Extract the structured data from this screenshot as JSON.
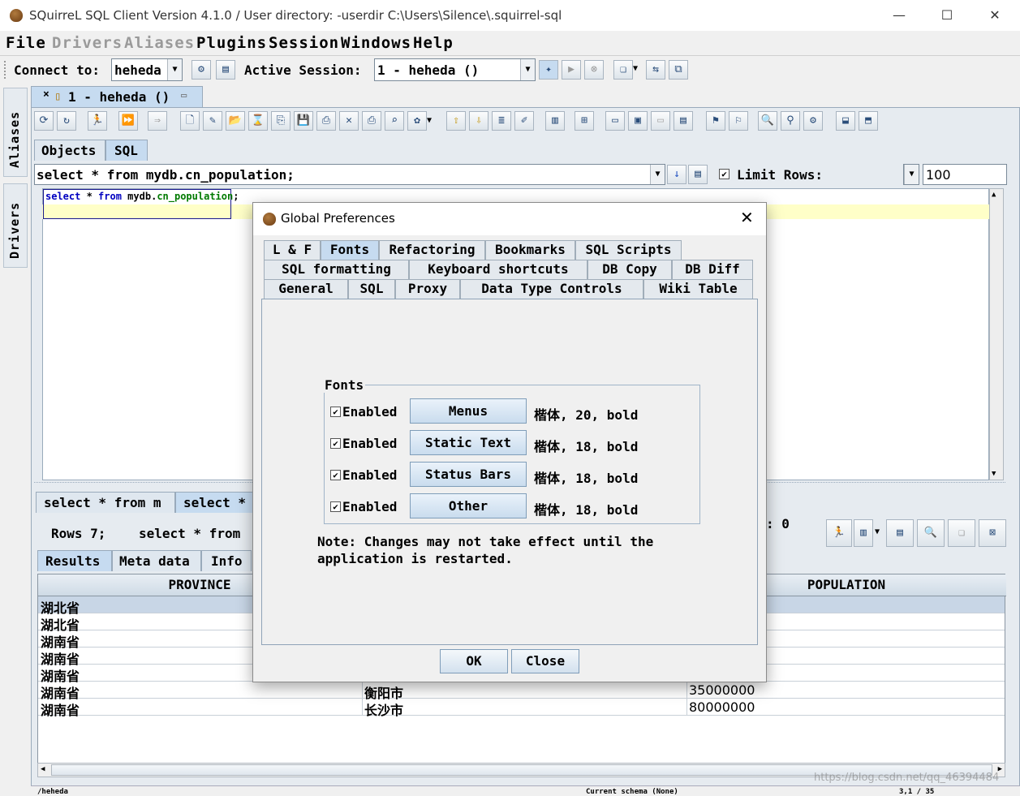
{
  "window": {
    "title": "SQuirreL SQL Client Version 4.1.0 / User directory: -userdir C:\\Users\\Silence\\.squirrel-sql",
    "minimize": "—",
    "maximize": "☐",
    "close": "✕"
  },
  "menubar": {
    "items": [
      {
        "label": "File",
        "enabled": true
      },
      {
        "label": "Drivers",
        "enabled": false
      },
      {
        "label": "Aliases",
        "enabled": false
      },
      {
        "label": "Plugins",
        "enabled": true
      },
      {
        "label": "Session",
        "enabled": true
      },
      {
        "label": "Windows",
        "enabled": true
      },
      {
        "label": "Help",
        "enabled": true
      }
    ]
  },
  "connectbar": {
    "connect_label": "Connect to:",
    "connect_value": "heheda",
    "active_session_label": "Active Session:",
    "active_session_value": "1 - heheda ()"
  },
  "lefttabs": {
    "aliases": "Aliases",
    "drivers": "Drivers"
  },
  "session": {
    "tab_label": "1 - heheda ()",
    "subtabs": {
      "objects": "Objects",
      "sql": "SQL"
    },
    "sql_combo_value": "select * from mydb.cn_population;",
    "limit_rows_label": "Limit Rows:",
    "limit_rows_checked": true,
    "limit_rows_value": "100",
    "editor": {
      "kw_select": "select",
      "star": " * ",
      "kw_from": "from",
      "schema": " mydb.",
      "table": "cn_population",
      "semicolon": ";"
    },
    "result_tabs": [
      "select * from m",
      "select *"
    ],
    "rows_info": "Rows 7;",
    "rows_sql": "select * from",
    "status_partial": ": 0",
    "result_subtabs": [
      "Results",
      "Meta data",
      "Info"
    ],
    "columns": [
      "PROVINCE",
      "POPULATION"
    ],
    "rows": [
      {
        "province": "湖北省",
        "city": "",
        "population": ""
      },
      {
        "province": "湖北省",
        "city": "",
        "population": ""
      },
      {
        "province": "湖南省",
        "city": "",
        "population": ""
      },
      {
        "province": "湖南省",
        "city": "",
        "population": ""
      },
      {
        "province": "湖南省",
        "city": "",
        "population": ""
      },
      {
        "province": "湖南省",
        "city": "衡阳市",
        "population": "35000000"
      },
      {
        "province": "湖南省",
        "city": "长沙市",
        "population": "80000000"
      }
    ],
    "statusbar_left": "/heheda",
    "statusbar_mid": "Current schema (None)",
    "statusbar_right": "3,1 / 35"
  },
  "dialog": {
    "title": "Global Preferences",
    "tabs_row1": [
      "L & F",
      "Fonts",
      "Refactoring",
      "Bookmarks",
      "SQL Scripts"
    ],
    "tabs_row2": [
      "SQL formatting",
      "Keyboard shortcuts",
      "DB Copy",
      "DB Diff"
    ],
    "tabs_row3": [
      "General",
      "SQL",
      "Proxy",
      "Data Type Controls",
      "Wiki Table"
    ],
    "active_tab": "Fonts",
    "group_title": "Fonts",
    "font_rows": [
      {
        "enabled_label": "Enabled",
        "checked": true,
        "button": "Menus",
        "value": "楷体, 20, bold"
      },
      {
        "enabled_label": "Enabled",
        "checked": true,
        "button": "Static Text",
        "value": "楷体, 18, bold"
      },
      {
        "enabled_label": "Enabled",
        "checked": true,
        "button": "Status Bars",
        "value": "楷体, 18, bold"
      },
      {
        "enabled_label": "Enabled",
        "checked": true,
        "button": "Other",
        "value": "楷体, 18, bold"
      }
    ],
    "note_line1": "Note: Changes may not take effect until the",
    "note_line2": "application is restarted.",
    "ok_label": "OK",
    "close_label": "Close"
  },
  "watermark": "https://blog.csdn.net/qq_46394484"
}
